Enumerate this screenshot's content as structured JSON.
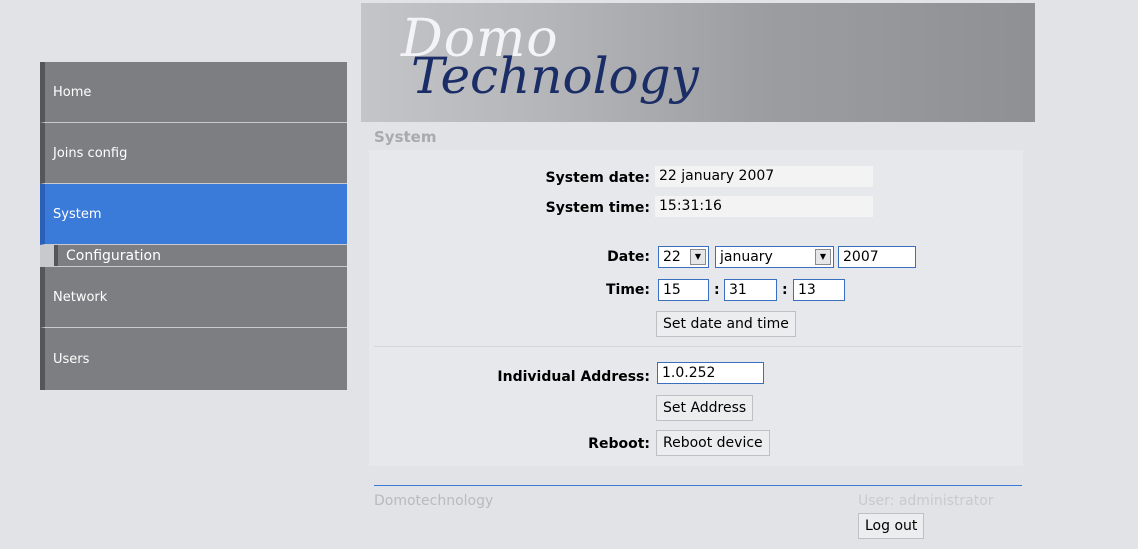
{
  "banner": {
    "logo_part1": "Domo",
    "logo_part2": "Technology"
  },
  "sidebar": {
    "items": [
      {
        "label": "Home"
      },
      {
        "label": "Joins config"
      },
      {
        "label": "System"
      },
      {
        "label": "Configuration"
      },
      {
        "label": "Network"
      },
      {
        "label": "Users"
      }
    ]
  },
  "main": {
    "title": "System",
    "system_date_label": "System date:",
    "system_date_value": "22 january 2007",
    "system_time_label": "System time:",
    "system_time_value": "15:31:16",
    "date_label": "Date:",
    "date_day": "22",
    "date_month": "january",
    "date_year": "2007",
    "time_label": "Time:",
    "time_hour": "15",
    "time_minute": "31",
    "time_second": "13",
    "colon": ":",
    "set_datetime_button": "Set date and time",
    "individual_address_label": "Individual Address:",
    "individual_address_value": "1.0.252",
    "set_address_button": "Set Address",
    "reboot_label": "Reboot:",
    "reboot_button": "Reboot device"
  },
  "footer": {
    "brand": "Domotechnology",
    "user": "User: administrator",
    "logout_button": "Log out"
  },
  "colors": {
    "active_nav": "#3a7ad9",
    "nav": "#7d7e81",
    "footer_line": "#3a7ad9"
  }
}
